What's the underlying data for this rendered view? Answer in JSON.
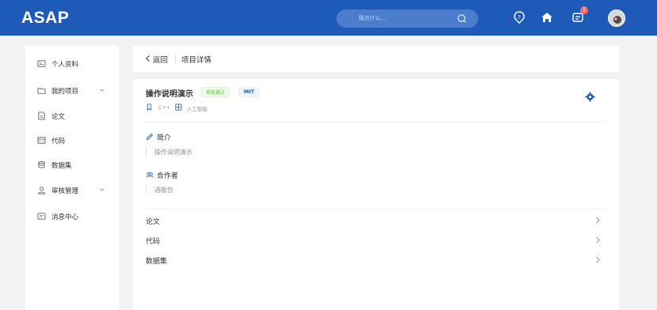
{
  "header": {
    "logo": "ASAP",
    "search_placeholder": "搜点什么...",
    "notification_count": "1",
    "icons": [
      "help-icon",
      "home-icon",
      "message-icon",
      "avatar"
    ],
    "bg_color": "#1e5bb8"
  },
  "sidebar": {
    "items": [
      {
        "label": "个人资料",
        "icon": "profile-card-icon",
        "expandable": false
      },
      {
        "label": "我的项目",
        "icon": "folder-icon",
        "expandable": true
      },
      {
        "label": "论文",
        "icon": "document-icon",
        "expandable": false
      },
      {
        "label": "代码",
        "icon": "code-icon",
        "expandable": false
      },
      {
        "label": "数据集",
        "icon": "database-icon",
        "expandable": false
      },
      {
        "label": "审核管理",
        "icon": "user-review-icon",
        "expandable": true
      },
      {
        "label": "消息中心",
        "icon": "message-icon",
        "expandable": false
      }
    ]
  },
  "breadcrumb": {
    "back_label": "返回",
    "current": "项目详情"
  },
  "project": {
    "title": "操作说明演示",
    "status": "审核通过",
    "license": "MIT",
    "language": "C++",
    "field": "人工智能",
    "intro_title": "简介",
    "intro_text": "操作说明演示",
    "collab_title": "合作者",
    "collab_text": "酒敬哲",
    "links": [
      "论文",
      "代码",
      "数据集"
    ]
  }
}
